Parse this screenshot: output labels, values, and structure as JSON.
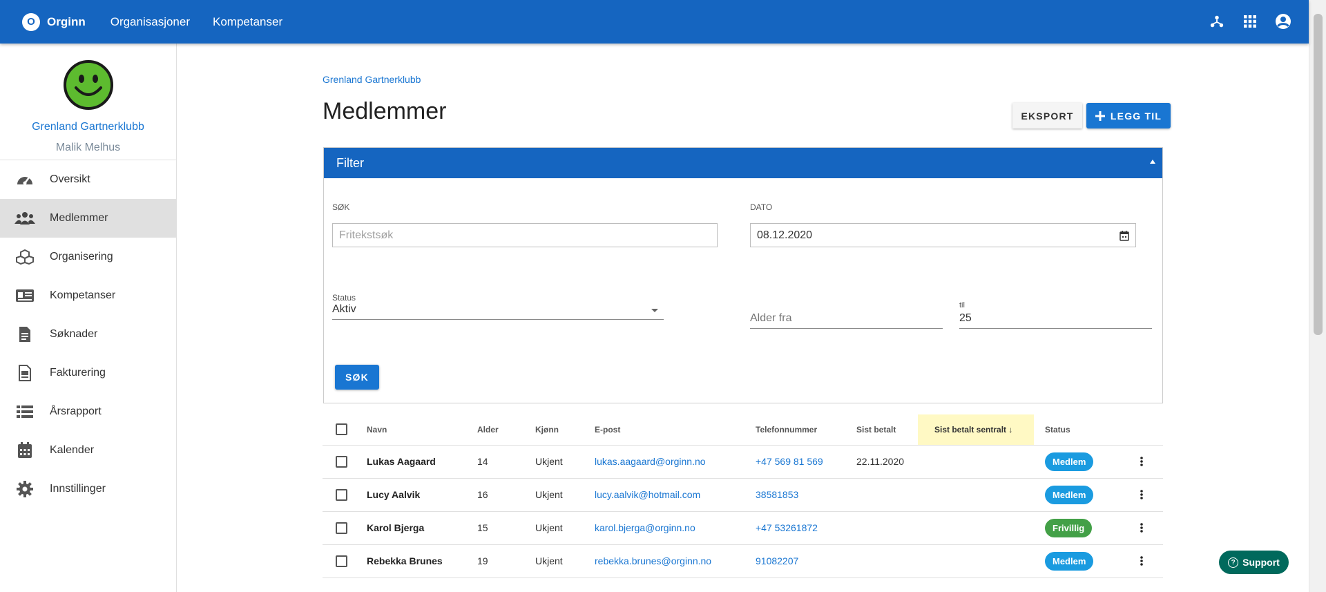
{
  "topbar": {
    "brand_letter": "O",
    "brand": "Orginn",
    "nav": [
      "Organisasjoner",
      "Kompetanser"
    ],
    "icons": [
      "hierarchy-icon",
      "apps-grid-icon",
      "account-circle-icon"
    ]
  },
  "sidebar": {
    "org_name": "Grenland Gartnerklubb",
    "user_name": "Malik Melhus",
    "items": [
      {
        "label": "Oversikt",
        "icon": "dashboard-icon"
      },
      {
        "label": "Medlemmer",
        "icon": "people-icon",
        "active": true
      },
      {
        "label": "Organisering",
        "icon": "cubes-icon"
      },
      {
        "label": "Kompetanser",
        "icon": "id-card-icon"
      },
      {
        "label": "Søknader",
        "icon": "document-icon"
      },
      {
        "label": "Fakturering",
        "icon": "invoice-icon"
      },
      {
        "label": "Årsrapport",
        "icon": "list-icon"
      },
      {
        "label": "Kalender",
        "icon": "calendar-icon"
      },
      {
        "label": "Innstillinger",
        "icon": "gear-icon"
      }
    ]
  },
  "main": {
    "breadcrumb": "Grenland Gartnerklubb",
    "title": "Medlemmer",
    "export_label": "EKSPORT",
    "add_label": "LEGG TIL"
  },
  "filter": {
    "title": "Filter",
    "search_label": "SØK",
    "search_placeholder": "Fritekstsøk",
    "date_label": "DATO",
    "date_value": "08.12.2020",
    "status_label": "Status",
    "status_value": "Aktiv",
    "age_from_placeholder": "Alder fra",
    "age_to_label": "til",
    "age_to_value": "25",
    "search_button": "SØK"
  },
  "table": {
    "headers": [
      "Navn",
      "Alder",
      "Kjønn",
      "E-post",
      "Telefonnummer",
      "Sist betalt",
      "Sist betalt sentralt",
      "Status"
    ],
    "rows": [
      {
        "name": "Lukas Aagaard",
        "age": "14",
        "gender": "Ukjent",
        "email": "lukas.aagaard@orginn.no",
        "phone": "+47 569 81 569",
        "last_paid": "22.11.2020",
        "last_paid_central": "",
        "status": "Medlem",
        "status_color": "#1a9be0"
      },
      {
        "name": "Lucy Aalvik",
        "age": "16",
        "gender": "Ukjent",
        "email": "lucy.aalvik@hotmail.com",
        "phone": "38581853",
        "last_paid": "",
        "last_paid_central": "",
        "status": "Medlem",
        "status_color": "#1a9be0"
      },
      {
        "name": "Karol Bjerga",
        "age": "15",
        "gender": "Ukjent",
        "email": "karol.bjerga@orginn.no",
        "phone": "+47 53261872",
        "last_paid": "",
        "last_paid_central": "",
        "status": "Frivillig",
        "status_color": "#43a047"
      },
      {
        "name": "Rebekka Brunes",
        "age": "19",
        "gender": "Ukjent",
        "email": "rebekka.brunes@orginn.no",
        "phone": "91082207",
        "last_paid": "",
        "last_paid_central": "",
        "status": "Medlem",
        "status_color": "#1a9be0"
      }
    ]
  },
  "support_label": "Support",
  "colors": {
    "primary": "#1565c0",
    "accent": "#1976d2",
    "sorted_col": "#fff9c4",
    "support": "#00695c"
  }
}
